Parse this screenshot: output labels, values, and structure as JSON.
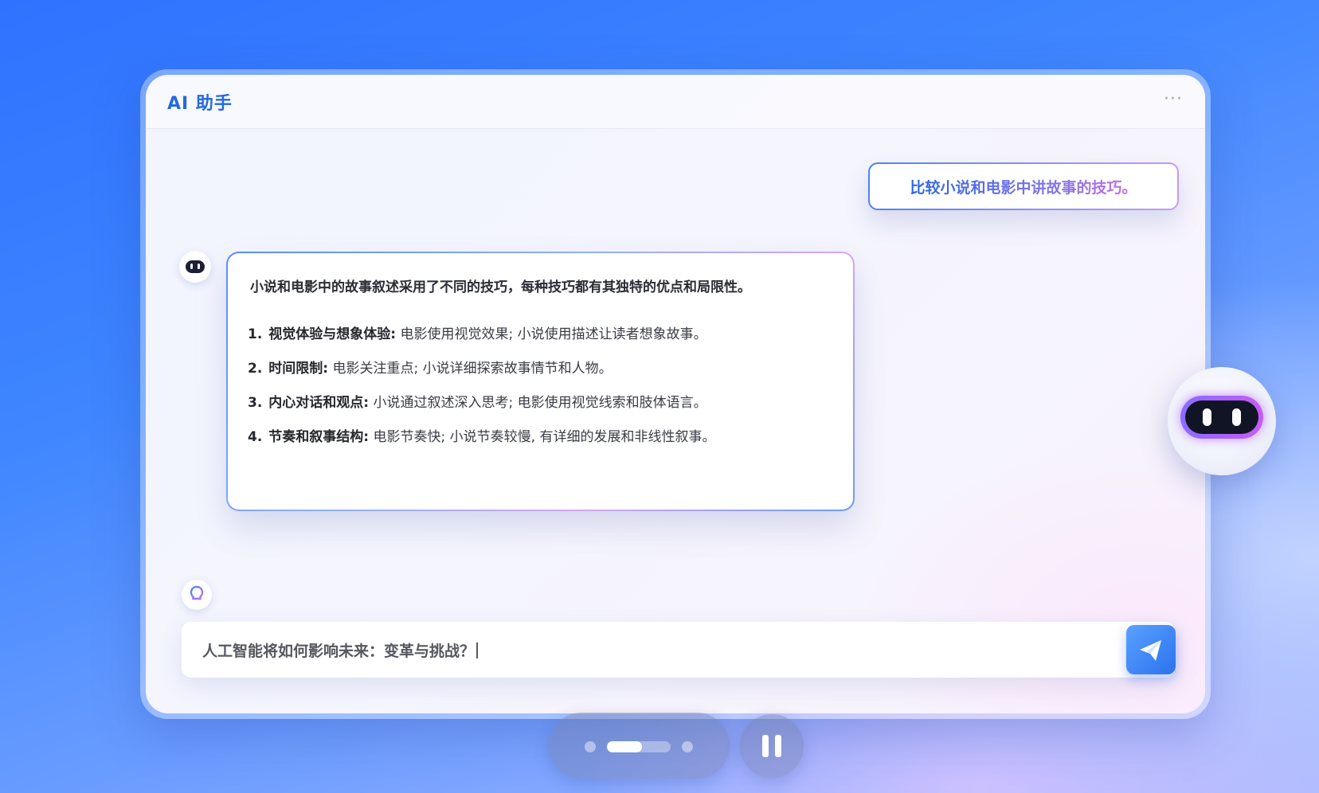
{
  "app": {
    "title": "AI 助手",
    "more_label": "···"
  },
  "chat": {
    "user_message": "比较小说和电影中讲故事的技巧。",
    "answer": {
      "intro": "小说和电影中的故事叙述采用了不同的技巧，每种技巧都有其独特的优点和局限性。",
      "items": [
        {
          "num": "1.",
          "term": "视觉体验与想象体验:",
          "text": " 电影使用视觉效果; 小说使用描述让读者想象故事。"
        },
        {
          "num": "2.",
          "term": "时间限制:",
          "text": " 电影关注重点; 小说详细探索故事情节和人物。"
        },
        {
          "num": "3.",
          "term": "内心对话和观点:",
          "text": " 小说通过叙述深入思考; 电影使用视觉线索和肢体语言。"
        },
        {
          "num": "4.",
          "term": "节奏和叙事结构:",
          "text": " 电影节奏快; 小说节奏较慢, 有详细的发展和非线性叙事。"
        }
      ]
    }
  },
  "input": {
    "value": "人工智能将如何影响未来：变革与挑战？"
  },
  "icons": {
    "bot_avatar": "robot-face-icon",
    "bulb": "lightbulb-icon",
    "send": "paper-plane-icon",
    "pause": "pause-icon"
  },
  "pager": {
    "pages": 4,
    "current": 2,
    "progress": 0.55
  },
  "colors": {
    "accent": "#2468e3",
    "send_button": "#2b72ee",
    "background": "#3f86ff"
  }
}
